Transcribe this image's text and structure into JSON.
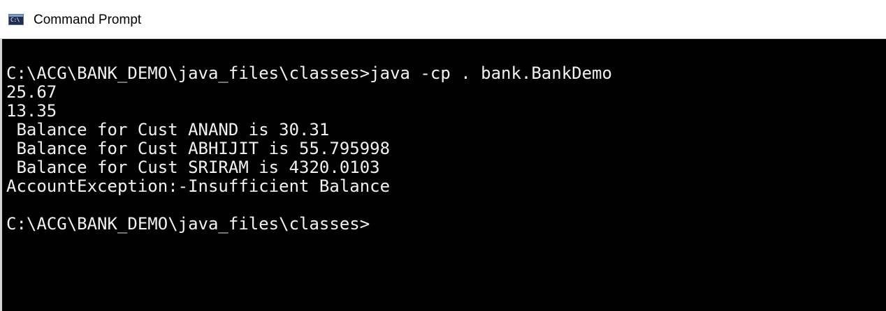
{
  "window": {
    "title": "Command Prompt",
    "icon": "cmd-console-icon",
    "icon_glyph": "C:\\"
  },
  "console": {
    "lines": [
      "C:\\ACG\\BANK_DEMO\\java_files\\classes>java -cp . bank.BankDemo",
      "25.67",
      "13.35",
      " Balance for Cust ANAND is 30.31",
      " Balance for Cust ABHIJIT is 55.795998",
      " Balance for Cust SRIRAM is 4320.0103",
      "AccountException:-Insufficient Balance",
      "",
      "C:\\ACG\\BANK_DEMO\\java_files\\classes>"
    ]
  },
  "colors": {
    "console_background": "#000000",
    "console_text": "#f2f2f2",
    "titlebar_background": "#ffffff"
  }
}
